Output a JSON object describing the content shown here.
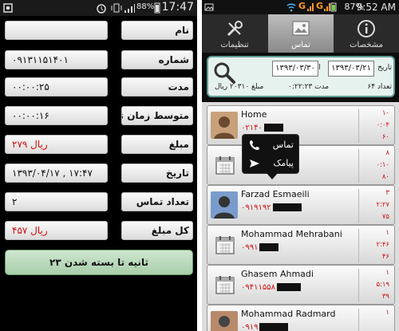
{
  "left": {
    "status": {
      "time": "17:47",
      "battery": "88%"
    },
    "rows": [
      {
        "label": "نام",
        "value": "",
        "red": false
      },
      {
        "label": "شماره",
        "value": "۰۹۱۳۱۱۵۱۴۰۱",
        "red": false
      },
      {
        "label": "مدت",
        "value": "۰۰:۰۰:۲۵",
        "red": false
      },
      {
        "label": "متوسط زمان تماس",
        "value": "۰۰:۰۰:۱۶",
        "red": false
      },
      {
        "label": "مبلغ",
        "value": "۲۷۹ ریال",
        "red": true
      },
      {
        "label": "تاریخ",
        "value": "۱۳۹۳/۰۴/۱۷ , ۱۷:۴۷",
        "red": false
      },
      {
        "label": "تعداد تماس",
        "value": "۲",
        "red": false
      },
      {
        "label": "کل مبلغ",
        "value": "۴۵۷ ریال",
        "red": true
      }
    ],
    "countdown": "۲۳ ثانیه تا بسته شدن"
  },
  "right": {
    "status": {
      "time": "9:52 AM",
      "battery": "87%"
    },
    "tabs": [
      {
        "label": "مشخصات",
        "icon": "info-icon",
        "active": false
      },
      {
        "label": "تماس",
        "icon": "picture-icon",
        "active": true
      },
      {
        "label": "تنظیمات",
        "icon": "tools-icon",
        "active": false
      }
    ],
    "filter": {
      "from_label": "تاریخ",
      "from_date": "۱۳۹۳/۰۳/۲۱",
      "to_label": "الی",
      "to_date": "۱۳۹۳/۰۳/۳۰",
      "count": "تعداد ۶۴",
      "duration": "مدت ۰:۲۲:۲۳",
      "amount": "مبلغ ۲۰۳۱۰ ریال"
    },
    "popup": {
      "call": "تماس",
      "sms": "پیامک"
    },
    "items": [
      {
        "name": "Home",
        "number": "۰۲۱۴۰",
        "stats": [
          "۱۰",
          "۰:۰۴",
          "۶۰"
        ],
        "avatar": "photo"
      },
      {
        "name": "",
        "number": "",
        "stats": [
          "۸",
          "۰:۱۰",
          "۸۰"
        ],
        "avatar": "calendar"
      },
      {
        "name": "Farzad Esmaeili",
        "number": "۰۹۱۹۱۹۲",
        "stats": [
          "۳",
          "۲:۲۷",
          "۷۵"
        ],
        "avatar": "photo2"
      },
      {
        "name": "Mohammad Mehrabani",
        "number": "۰۹۹۱",
        "stats": [
          "۱",
          "۲:۴۶",
          "۴۶"
        ],
        "avatar": "calendar"
      },
      {
        "name": "Ghasem Ahmadi",
        "number": "۰۹۴۱۱۵۵۸",
        "stats": [
          "۱",
          "۵:۱۹",
          "۳۹"
        ],
        "avatar": "calendar"
      },
      {
        "name": "Mohammad Radmard",
        "number": "۰۹۱۹",
        "stats": [
          "۱",
          "",
          ""
        ],
        "avatar": "photo3"
      }
    ]
  }
}
